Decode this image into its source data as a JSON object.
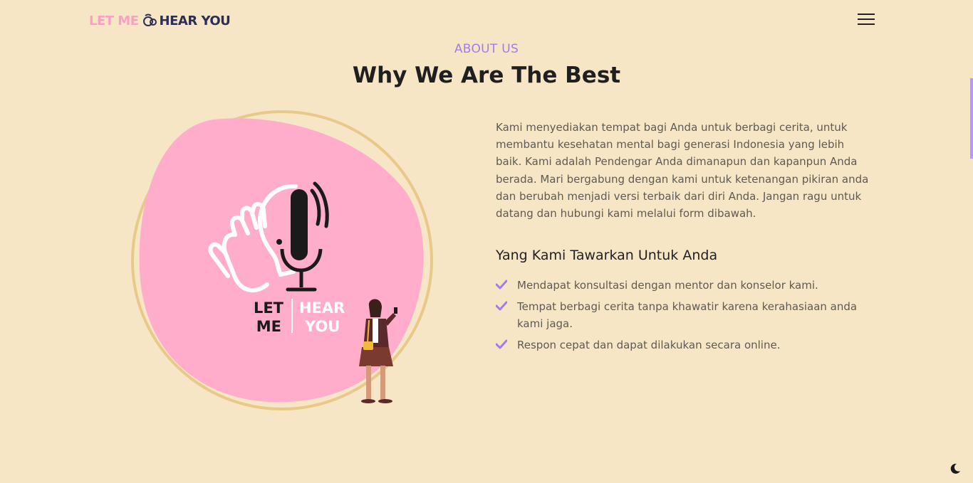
{
  "header": {
    "logo_part1": "LET ME",
    "logo_part2": "HEAR YOU",
    "menu_icon": "hamburger-icon"
  },
  "about": {
    "eyebrow": "ABOUT US",
    "title": "Why We Are The Best",
    "description": "Kami menyediakan tempat bagi Anda untuk berbagi cerita, untuk membantu kesehatan mental bagi generasi Indonesia yang lebih baik. Kami adalah Pendengar Anda dimanapun dan kapanpun Anda berada. Mari bergabung dengan kami untuk ketenangan pikiran anda dan berubah menjadi versi terbaik dari diri Anda. Jangan ragu untuk datang dan hubungi kami melalui form dibawah.",
    "offer_heading": "Yang Kami Tawarkan Untuk Anda",
    "offers": [
      "Mendapat konsultasi dengan mentor dan konselor kami.",
      "Tempat berbagi cerita tanpa khawatir karena kerahasiaan anda kami jaga.",
      "Respon cepat dan dapat dilakukan secara online."
    ]
  },
  "illustration": {
    "logo_left_top": "LET",
    "logo_left_bottom": "ME",
    "logo_right_top": "HEAR",
    "logo_right_bottom": "YOU"
  },
  "colors": {
    "background": "#f6e6c5",
    "accent_purple": "#a47ce8",
    "blob_pink": "#ffadcb",
    "ring_gold": "#e8c98a",
    "logo_pink": "#f6a3c3",
    "logo_dark": "#2c2f55"
  },
  "icons": {
    "check": "check-icon",
    "theme": "moon-icon"
  }
}
